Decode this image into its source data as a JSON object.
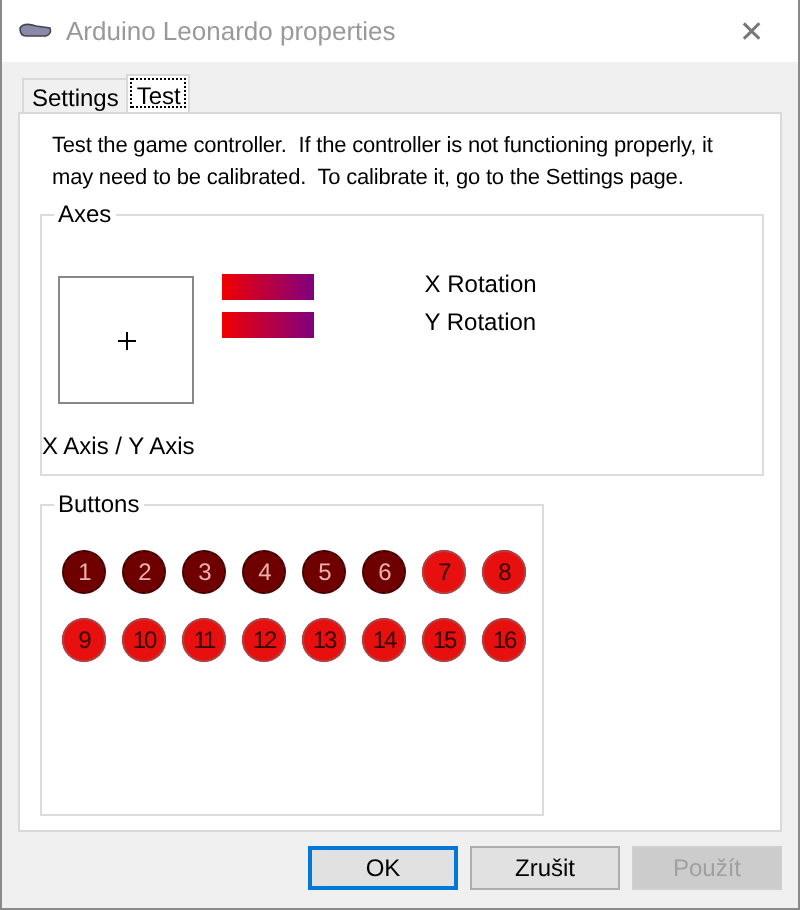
{
  "window": {
    "title": "Arduino Leonardo properties",
    "close": "✕"
  },
  "tabs": [
    {
      "label": "Settings",
      "selected": false
    },
    {
      "label": "Test",
      "selected": true
    }
  ],
  "intro": "Test the game controller.  If the controller is not functioning properly, it may need to be calibrated.  To calibrate it, go to the Settings page.",
  "axes": {
    "title": "Axes",
    "xy_label": "X Axis / Y Axis",
    "rotations": [
      {
        "label": "X Rotation"
      },
      {
        "label": "Y Rotation"
      }
    ]
  },
  "buttons_group": {
    "title": "Buttons",
    "buttons": [
      {
        "label": "1",
        "on": false
      },
      {
        "label": "2",
        "on": false
      },
      {
        "label": "3",
        "on": false
      },
      {
        "label": "4",
        "on": false
      },
      {
        "label": "5",
        "on": false
      },
      {
        "label": "6",
        "on": false
      },
      {
        "label": "7",
        "on": true
      },
      {
        "label": "8",
        "on": true
      },
      {
        "label": "9",
        "on": true
      },
      {
        "label": "10",
        "on": true
      },
      {
        "label": "11",
        "on": true
      },
      {
        "label": "12",
        "on": true
      },
      {
        "label": "13",
        "on": true
      },
      {
        "label": "14",
        "on": true
      },
      {
        "label": "15",
        "on": true
      },
      {
        "label": "16",
        "on": true
      }
    ]
  },
  "dialog_buttons": [
    {
      "label": "OK",
      "disabled": false,
      "default": true
    },
    {
      "label": "Zrušit",
      "disabled": false,
      "default": false
    },
    {
      "label": "Použít",
      "disabled": true,
      "default": false
    }
  ]
}
